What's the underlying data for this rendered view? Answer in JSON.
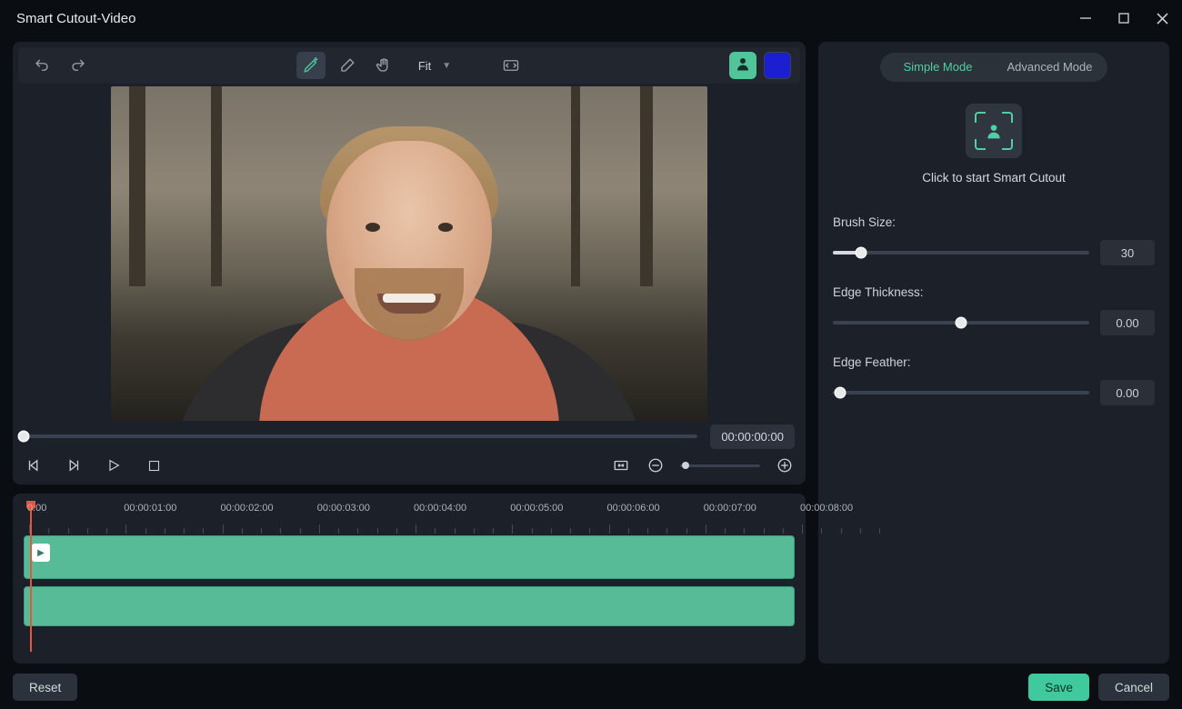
{
  "window": {
    "title": "Smart Cutout-Video"
  },
  "toolbar": {
    "zoom_label": "Fit"
  },
  "transport": {
    "timecode": "00:00:00:00"
  },
  "timeline": {
    "labels": [
      "0:00",
      "00:00:01:00",
      "00:00:02:00",
      "00:00:03:00",
      "00:00:04:00",
      "00:00:05:00",
      "00:00:06:00",
      "00:00:07:00",
      "00:00:08:00"
    ]
  },
  "side": {
    "tabs": {
      "simple": "Simple Mode",
      "advanced": "Advanced Mode"
    },
    "start_hint": "Click to start Smart Cutout",
    "params": {
      "brush_size": {
        "label": "Brush Size:",
        "value": "30",
        "pct": 11
      },
      "edge_thickness": {
        "label": "Edge Thickness:",
        "value": "0.00",
        "pct": 50
      },
      "edge_feather": {
        "label": "Edge Feather:",
        "value": "0.00",
        "pct": 3
      }
    }
  },
  "footer": {
    "reset": "Reset",
    "save": "Save",
    "cancel": "Cancel"
  }
}
